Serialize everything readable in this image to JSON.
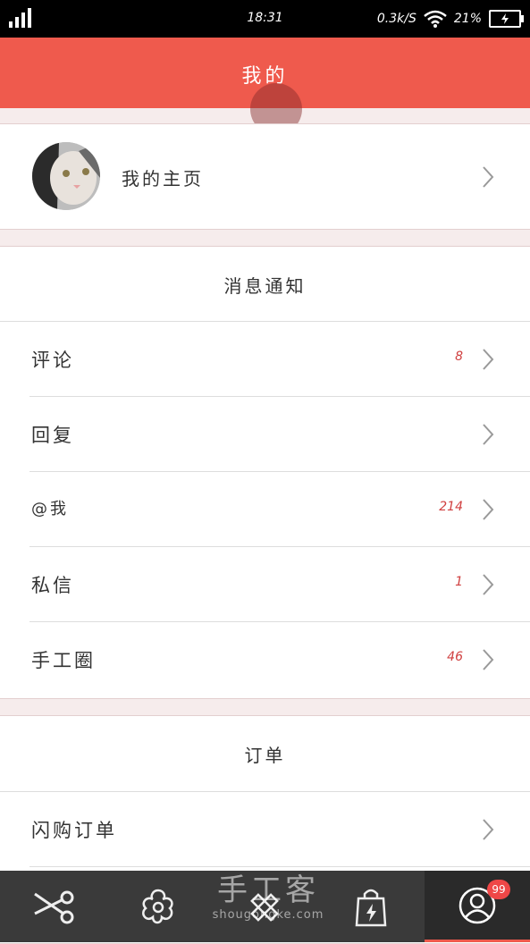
{
  "status_bar": {
    "time": "18:31",
    "speed": "0.3k/S",
    "battery": "21%"
  },
  "header": {
    "title": "我的"
  },
  "profile": {
    "label": "我的主页"
  },
  "notifications": {
    "title": "消息通知",
    "items": [
      {
        "label": "评论",
        "count": "8"
      },
      {
        "label": "回复",
        "count": ""
      },
      {
        "label": "@我",
        "count": "214"
      },
      {
        "label": "私信",
        "count": "1"
      },
      {
        "label": "手工圈",
        "count": "46"
      }
    ]
  },
  "orders": {
    "title": "订单",
    "items": [
      {
        "label": "闪购订单"
      }
    ]
  },
  "bottom_nav": {
    "items": [
      {
        "icon": "scissors-icon"
      },
      {
        "icon": "flower-icon"
      },
      {
        "icon": "pencil-ruler-icon"
      },
      {
        "icon": "shopping-bag-icon"
      },
      {
        "icon": "user-icon",
        "badge": "99",
        "active": true
      }
    ]
  },
  "watermark": {
    "big": "手工客",
    "small": "shougongke.com"
  },
  "colors": {
    "accent": "#ef5a4d",
    "badge": "#ef4747",
    "nav_bg": "#3a3a3a"
  }
}
